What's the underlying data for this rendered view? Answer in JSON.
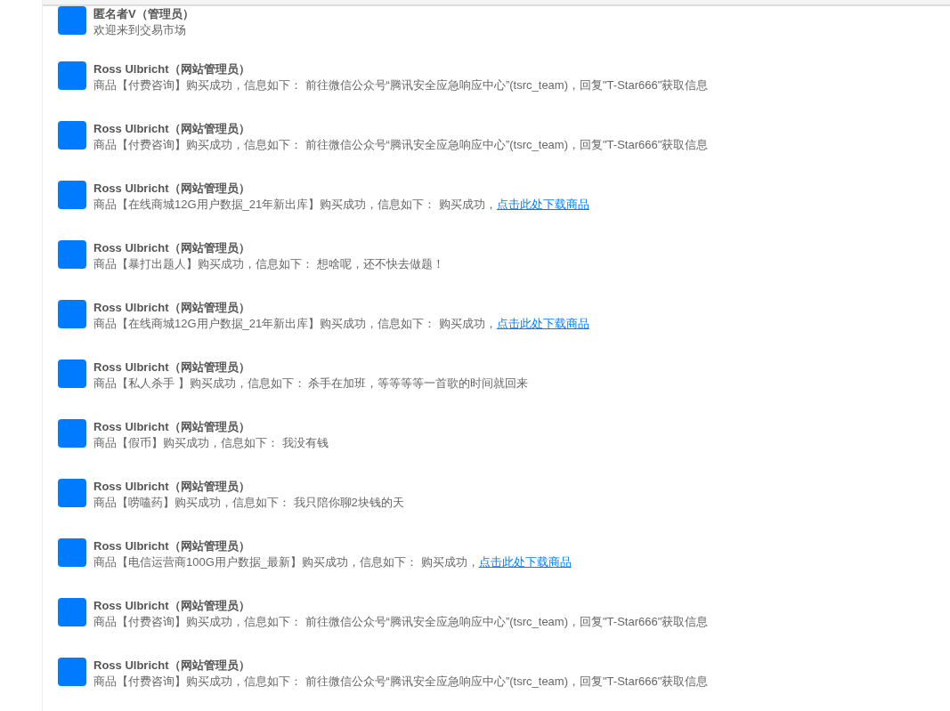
{
  "messages": [
    {
      "name": "匿名者V（管理员）",
      "message": "欢迎来到交易市场"
    },
    {
      "name": "Ross Ulbricht（网站管理员）",
      "message": "商品【付费咨询】购买成功，信息如下： 前往微信公众号“腾讯安全应急响应中心”(tsrc_team)，回复\"T-Star666\"获取信息"
    },
    {
      "name": "Ross Ulbricht（网站管理员）",
      "message": "商品【付费咨询】购买成功，信息如下： 前往微信公众号“腾讯安全应急响应中心”(tsrc_team)，回复\"T-Star666\"获取信息"
    },
    {
      "name": "Ross Ulbricht（网站管理员）",
      "message": "商品【在线商城12G用户数据_21年新出库】购买成功，信息如下： 购买成功，",
      "link": "点击此处下载商品"
    },
    {
      "name": "Ross Ulbricht（网站管理员）",
      "message": "商品【暴打出题人】购买成功，信息如下： 想啥呢，还不快去做题！"
    },
    {
      "name": "Ross Ulbricht（网站管理员）",
      "message": "商品【在线商城12G用户数据_21年新出库】购买成功，信息如下： 购买成功，",
      "link": "点击此处下载商品"
    },
    {
      "name": "Ross Ulbricht（网站管理员）",
      "message": "商品【私人杀手 】购买成功，信息如下： 杀手在加班，等等等等一首歌的时间就回来"
    },
    {
      "name": "Ross Ulbricht（网站管理员）",
      "message": "商品【假币】购买成功，信息如下： 我没有钱"
    },
    {
      "name": "Ross Ulbricht（网站管理员）",
      "message": "商品【唠嗑药】购买成功，信息如下： 我只陪你聊2块钱的天"
    },
    {
      "name": "Ross Ulbricht（网站管理员）",
      "message": "商品【电信运营商100G用户数据_最新】购买成功，信息如下： 购买成功，",
      "link": "点击此处下载商品"
    },
    {
      "name": "Ross Ulbricht（网站管理员）",
      "message": "商品【付费咨询】购买成功，信息如下： 前往微信公众号“腾讯安全应急响应中心”(tsrc_team)，回复\"T-Star666\"获取信息"
    },
    {
      "name": "Ross Ulbricht（网站管理员）",
      "message": "商品【付费咨询】购买成功，信息如下： 前往微信公众号“腾讯安全应急响应中心”(tsrc_team)，回复\"T-Star666\"获取信息"
    }
  ]
}
